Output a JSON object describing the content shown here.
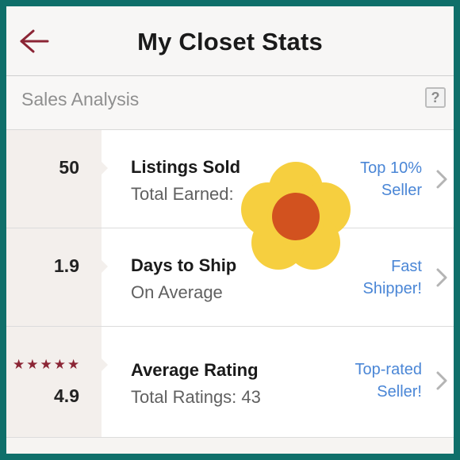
{
  "nav": {
    "title": "My Closet Stats",
    "back_icon": "arrow-left-icon"
  },
  "section": {
    "title": "Sales Analysis",
    "help_label": "?"
  },
  "rows": [
    {
      "stat": "50",
      "label": "Listings Sold",
      "sublabel": "Total Earned:",
      "badge_line1": "Top 10%",
      "badge_line2": "Seller"
    },
    {
      "stat": "1.9",
      "label": "Days to Ship",
      "sublabel": "On Average",
      "badge_line1": "Fast",
      "badge_line2": "Shipper!"
    },
    {
      "stat": "4.9",
      "stars": 5,
      "label": "Average Rating",
      "sublabel": "Total Ratings: 43",
      "badge_line1": "Top-rated",
      "badge_line2": "Seller!"
    }
  ],
  "colors": {
    "accent": "#8b2535",
    "link": "#4a86d6",
    "frame": "#0f6f6a",
    "flower_petal": "#f6cf3f",
    "flower_center": "#d2521f"
  }
}
